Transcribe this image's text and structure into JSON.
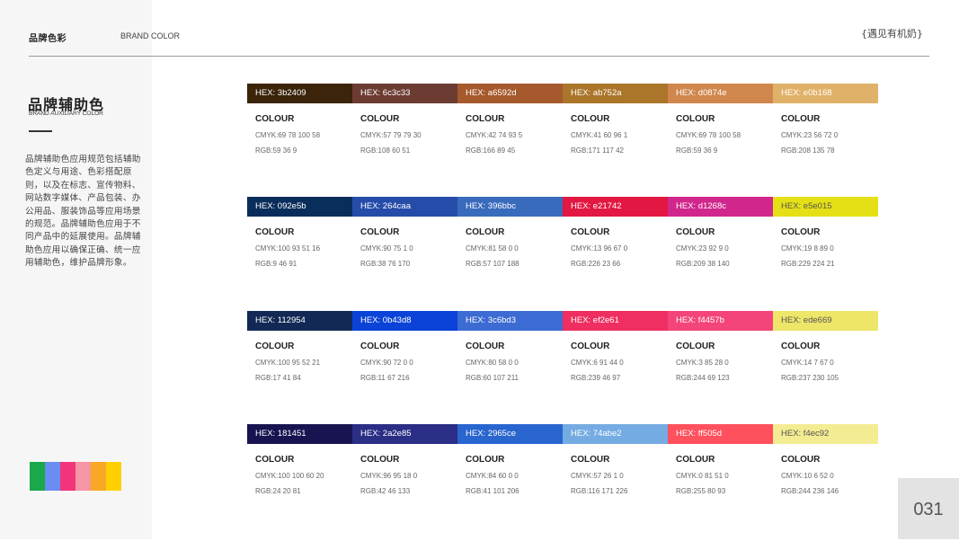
{
  "header": {
    "title_cn": "品牌色彩",
    "title_en": "BRAND COLOR",
    "right_label": "{遇见有机奶}"
  },
  "section": {
    "title": "品牌辅助色",
    "subtitle": "BRAND AUXILIARY COLOR",
    "description": "品牌辅助色应用规范包括辅助色定义与用途、色彩搭配原则，以及在标志、宣传物料、网站数字媒体、产品包装、办公用品、服装饰品等应用场景的规范。品牌辅助色应用于不同产品中的延展使用。品牌辅助色应用以确保正确、统一应用辅助色，维护品牌形象。"
  },
  "mini_palette": [
    "#1aa84a",
    "#6b8cf0",
    "#f2357a",
    "#f595a5",
    "#f9a825",
    "#ffd000"
  ],
  "swatch_rows": [
    [
      {
        "hex_label": "HEX: 3b2409",
        "color": "#3b2409",
        "text_color": "#ffffff",
        "colour": "COLOUR",
        "cmyk": "CMYK:69 78 100 58",
        "rgb": "RGB:59 36 9"
      },
      {
        "hex_label": "HEX: 6c3c33",
        "color": "#6c3c33",
        "text_color": "#ffffff",
        "colour": "COLOUR",
        "cmyk": "CMYK:57 79 79 30",
        "rgb": "RGB:108 60 51"
      },
      {
        "hex_label": "HEX: a6592d",
        "color": "#a6592d",
        "text_color": "#ffffff",
        "colour": "COLOUR",
        "cmyk": "CMYK:42 74 93 5",
        "rgb": "RGB:166 89 45"
      },
      {
        "hex_label": "HEX: ab752a",
        "color": "#ab752a",
        "text_color": "#ffffff",
        "colour": "COLOUR",
        "cmyk": "CMYK:41 60 96 1",
        "rgb": "RGB:171 117 42"
      },
      {
        "hex_label": "HEX: d0874e",
        "color": "#d0874e",
        "text_color": "#ffffff",
        "colour": "COLOUR",
        "cmyk": "CMYK:69 78 100 58",
        "rgb": "RGB:59 36 9"
      },
      {
        "hex_label": "HEX: e0b168",
        "color": "#e0b168",
        "text_color": "#ffffff",
        "colour": "COLOUR",
        "cmyk": "CMYK:23 56 72 0",
        "rgb": "RGB:208 135 78"
      }
    ],
    [
      {
        "hex_label": "HEX: 092e5b",
        "color": "#092e5b",
        "text_color": "#ffffff",
        "colour": "COLOUR",
        "cmyk": "CMYK:100 93 51 16",
        "rgb": "RGB:9 46 91"
      },
      {
        "hex_label": "HEX: 264caa",
        "color": "#264caa",
        "text_color": "#ffffff",
        "colour": "COLOUR",
        "cmyk": "CMYK:90 75 1 0",
        "rgb": "RGB:38 76 170"
      },
      {
        "hex_label": "HEX: 396bbc",
        "color": "#396bbc",
        "text_color": "#ffffff",
        "colour": "COLOUR",
        "cmyk": "CMYK:81 58 0 0",
        "rgb": "RGB:57 107 188"
      },
      {
        "hex_label": "HEX: e21742",
        "color": "#e21742",
        "text_color": "#ffffff",
        "colour": "COLOUR",
        "cmyk": "CMYK:13 96 67 0",
        "rgb": "RGB:226 23 66"
      },
      {
        "hex_label": "HEX: d1268c",
        "color": "#d1268c",
        "text_color": "#ffffff",
        "colour": "COLOUR",
        "cmyk": "CMYK:23 92 9 0",
        "rgb": "RGB:209 38 140"
      },
      {
        "hex_label": "HEX: e5e015",
        "color": "#e5e015",
        "text_color": "#555555",
        "colour": "COLOUR",
        "cmyk": "CMYK:19 8 89 0",
        "rgb": "RGB:229 224 21"
      }
    ],
    [
      {
        "hex_label": "HEX: 112954",
        "color": "#112954",
        "text_color": "#ffffff",
        "colour": "COLOUR",
        "cmyk": "CMYK:100 95 52 21",
        "rgb": "RGB:17 41 84"
      },
      {
        "hex_label": "HEX: 0b43d8",
        "color": "#0b43d8",
        "text_color": "#ffffff",
        "colour": "COLOUR",
        "cmyk": "CMYK:90 72 0 0",
        "rgb": "RGB:11 67 216"
      },
      {
        "hex_label": "HEX: 3c6bd3",
        "color": "#3c6bd3",
        "text_color": "#ffffff",
        "colour": "COLOUR",
        "cmyk": "CMYK:80 58 0 0",
        "rgb": "RGB:60 107 211"
      },
      {
        "hex_label": "HEX: ef2e61",
        "color": "#ef2e61",
        "text_color": "#ffffff",
        "colour": "COLOUR",
        "cmyk": "CMYK:6 91 44 0",
        "rgb": "RGB:239 46 97"
      },
      {
        "hex_label": "HEX: f4457b",
        "color": "#f4457b",
        "text_color": "#ffffff",
        "colour": "COLOUR",
        "cmyk": "CMYK:3 85 28 0",
        "rgb": "RGB:244 69 123"
      },
      {
        "hex_label": "HEX: ede669",
        "color": "#ede669",
        "text_color": "#555555",
        "colour": "COLOUR",
        "cmyk": "CMYK:14 7 67 0",
        "rgb": "RGB:237 230 105"
      }
    ],
    [
      {
        "hex_label": "HEX: 181451",
        "color": "#181451",
        "text_color": "#ffffff",
        "colour": "COLOUR",
        "cmyk": "CMYK:100 100 60 20",
        "rgb": "RGB:24 20 81"
      },
      {
        "hex_label": "HEX: 2a2e85",
        "color": "#2a2e85",
        "text_color": "#ffffff",
        "colour": "COLOUR",
        "cmyk": "CMYK:96 95 18 0",
        "rgb": "RGB:42 46 133"
      },
      {
        "hex_label": "HEX: 2965ce",
        "color": "#2965ce",
        "text_color": "#ffffff",
        "colour": "COLOUR",
        "cmyk": "CMYK:84 60 0 0",
        "rgb": "RGB:41 101 206"
      },
      {
        "hex_label": "HEX: 74abe2",
        "color": "#74abe2",
        "text_color": "#ffffff",
        "colour": "COLOUR",
        "cmyk": "CMYK:57 26 1 0",
        "rgb": "RGB:116 171 226"
      },
      {
        "hex_label": "HEX: ff505d",
        "color": "#ff505d",
        "text_color": "#ffffff",
        "colour": "COLOUR",
        "cmyk": "CMYK:0 81 51 0",
        "rgb": "RGB:255 80 93"
      },
      {
        "hex_label": "HEX: f4ec92",
        "color": "#f4ec92",
        "text_color": "#555555",
        "colour": "COLOUR",
        "cmyk": "CMYK:10 6 52 0",
        "rgb": "RGB:244 236 146"
      }
    ]
  ],
  "page_number": "031"
}
